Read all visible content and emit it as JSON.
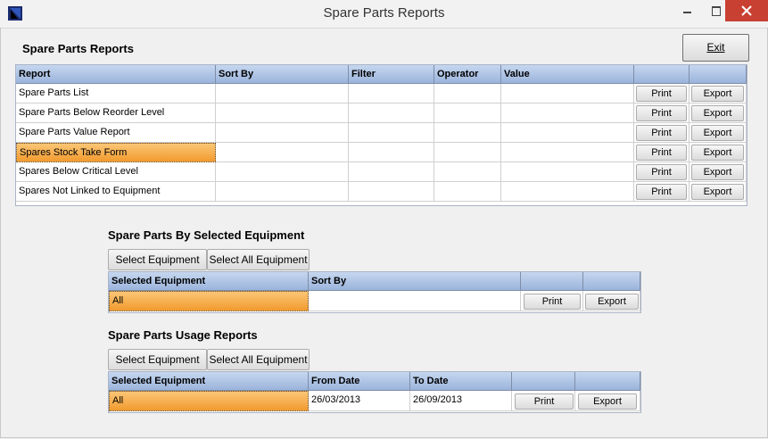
{
  "window": {
    "title": "Spare Parts Reports",
    "icon": "app-logo-icon",
    "controls": [
      "minimize-icon",
      "maximize-icon",
      "close-icon"
    ]
  },
  "exit_label": "Exit",
  "reports": {
    "heading": "Spare Parts Reports",
    "columns": [
      "Report",
      "Sort By",
      "Filter",
      "Operator",
      "Value"
    ],
    "print_label": "Print",
    "export_label": "Export",
    "rows": [
      {
        "report": "Spare Parts List",
        "selected": false
      },
      {
        "report": "Spare Parts Below Reorder Level",
        "selected": false
      },
      {
        "report": "Spare Parts Value Report",
        "selected": false
      },
      {
        "report": "Spares Stock Take Form",
        "selected": true
      },
      {
        "report": "Spares Below Critical Level",
        "selected": false
      },
      {
        "report": "Spares Not Linked to Equipment",
        "selected": false
      }
    ]
  },
  "by_equipment": {
    "heading": "Spare Parts By Selected Equipment",
    "select_label": "Select Equipment",
    "select_all_label": "Select All Equipment",
    "columns": [
      "Selected Equipment",
      "Sort By"
    ],
    "row": {
      "equipment": "All",
      "sort_by": ""
    },
    "print_label": "Print",
    "export_label": "Export"
  },
  "usage": {
    "heading": "Spare Parts Usage Reports",
    "select_label": "Select Equipment",
    "select_all_label": "Select All Equipment",
    "columns": [
      "Selected Equipment",
      "From Date",
      "To Date"
    ],
    "row": {
      "equipment": "All",
      "from_date": "26/03/2013",
      "to_date": "26/09/2013"
    },
    "print_label": "Print",
    "export_label": "Export"
  },
  "colors": {
    "header_gradient_top": "#c6d7ef",
    "header_gradient_bottom": "#9bb4dc",
    "selection_orange": "#f29a2e",
    "close_button": "#c84031"
  }
}
